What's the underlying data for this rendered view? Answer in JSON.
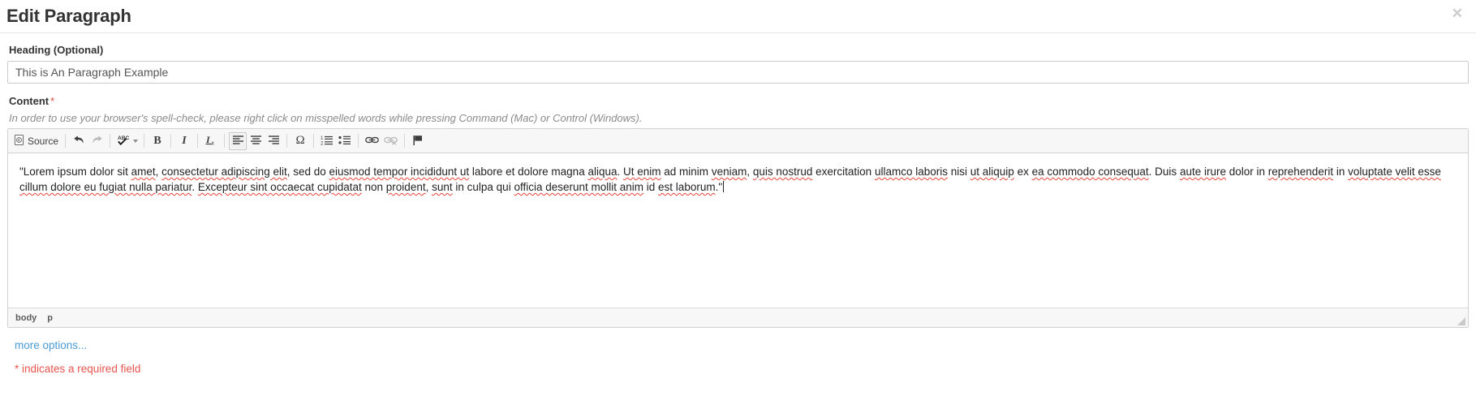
{
  "modal": {
    "title": "Edit Paragraph",
    "close_icon": "close-icon",
    "close_glyph": "✕"
  },
  "heading_field": {
    "label": "Heading (Optional)",
    "value": "This is An Paragraph Example",
    "placeholder": ""
  },
  "content_field": {
    "label": "Content",
    "required_marker": "*",
    "help_text": "In order to use your browser's spell-check, please right click on misspelled words while pressing Command (Mac) or Control (Windows)."
  },
  "editor": {
    "toolbar": {
      "source_label": "Source",
      "buttons": [
        {
          "name": "source-button",
          "label": "Source",
          "icon": "source-icon",
          "state": "enabled"
        },
        {
          "name": "undo-button",
          "label": "Undo",
          "icon": "undo-arrow-icon",
          "state": "enabled"
        },
        {
          "name": "redo-button",
          "label": "Redo",
          "icon": "redo-arrow-icon",
          "state": "disabled"
        },
        {
          "name": "spellcheck-button",
          "label": "Spell Check As You Type",
          "icon": "abc-check-icon",
          "state": "enabled",
          "has_dropdown": true
        },
        {
          "name": "bold-button",
          "label": "Bold",
          "icon": "bold-icon",
          "glyph": "B",
          "state": "enabled"
        },
        {
          "name": "italic-button",
          "label": "Italic",
          "icon": "italic-icon",
          "glyph": "I",
          "state": "enabled"
        },
        {
          "name": "remove-format-button",
          "label": "Remove Format",
          "icon": "remove-format-icon",
          "glyph": "I",
          "sub": "x",
          "state": "enabled"
        },
        {
          "name": "align-left-button",
          "label": "Align Left",
          "icon": "align-left-icon",
          "state": "active"
        },
        {
          "name": "align-center-button",
          "label": "Center",
          "icon": "align-center-icon",
          "state": "enabled"
        },
        {
          "name": "align-right-button",
          "label": "Align Right",
          "icon": "align-right-icon",
          "state": "enabled"
        },
        {
          "name": "special-character-button",
          "label": "Insert Special Character",
          "icon": "omega-icon",
          "glyph": "Ω",
          "state": "enabled"
        },
        {
          "name": "numbered-list-button",
          "label": "Insert/Remove Numbered List",
          "icon": "numbered-list-icon",
          "state": "enabled"
        },
        {
          "name": "bulleted-list-button",
          "label": "Insert/Remove Bulleted List",
          "icon": "bulleted-list-icon",
          "state": "enabled"
        },
        {
          "name": "link-button",
          "label": "Link",
          "icon": "chain-link-icon",
          "state": "enabled"
        },
        {
          "name": "unlink-button",
          "label": "Unlink",
          "icon": "chain-broken-icon",
          "state": "disabled"
        },
        {
          "name": "anchor-button",
          "label": "Anchor",
          "icon": "flag-anchor-icon",
          "state": "enabled"
        }
      ]
    },
    "content_text": "\"Lorem ipsum dolor sit amet, consectetur adipiscing elit, sed do eiusmod tempor incididunt ut labore et dolore magna aliqua. Ut enim ad minim veniam, quis nostrud exercitation ullamco laboris nisi ut aliquip ex ea commodo consequat. Duis aute irure dolor in reprehenderit in voluptate velit esse cillum dolore eu fugiat nulla pariatur. Excepteur sint occaecat cupidatat non proident, sunt in culpa qui officia deserunt mollit anim id est laborum.\"",
    "element_path": [
      "body",
      "p"
    ],
    "resize_handle": "resize-grip-icon"
  },
  "footer": {
    "more_options_label": "more options...",
    "required_note": "* indicates a required field"
  },
  "colors": {
    "link": "#4a9ad4",
    "required": "#e8554d",
    "spellcheck_underline": "#e8443a",
    "toolbar_bg": "#f7f7f7",
    "border": "#d1d1d1",
    "title": "#333333"
  }
}
